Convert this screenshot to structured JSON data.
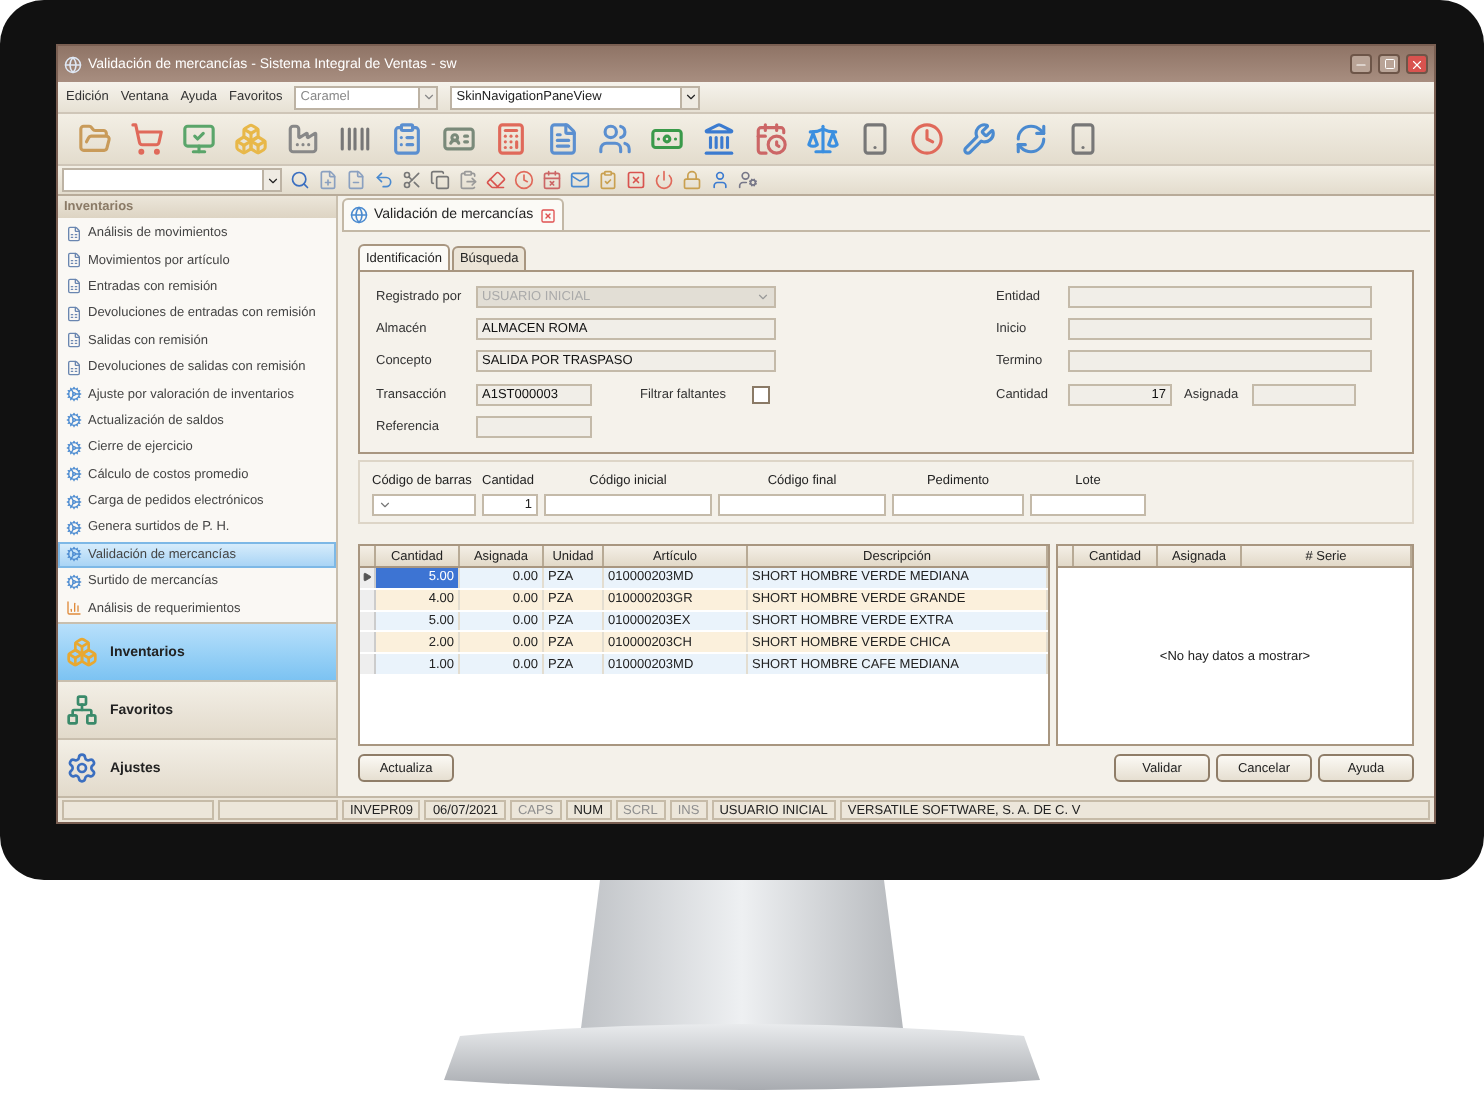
{
  "window": {
    "title": "Validación de mercancías - Sistema Integral de Ventas - sw"
  },
  "menu": [
    "Edición",
    "Ventana",
    "Ayuda",
    "Favoritos"
  ],
  "skin_combo": {
    "value": "Caramel"
  },
  "view_combo": {
    "value": "SkinNavigationPaneView"
  },
  "sidebar": {
    "title": "Inventarios",
    "items": [
      {
        "label": "Análisis de movimientos",
        "kind": "report",
        "selected": false
      },
      {
        "label": "Movimientos por artículo",
        "kind": "report",
        "selected": false
      },
      {
        "label": "Entradas con remisión",
        "kind": "report",
        "selected": false
      },
      {
        "label": "Devoluciones de entradas con remisión",
        "kind": "report",
        "selected": false
      },
      {
        "label": "Salidas con remisión",
        "kind": "report",
        "selected": false
      },
      {
        "label": "Devoluciones de salidas con remisión",
        "kind": "report",
        "selected": false
      },
      {
        "label": "Ajuste por valoración de inventarios",
        "kind": "process",
        "selected": false
      },
      {
        "label": "Actualización de saldos",
        "kind": "process",
        "selected": false
      },
      {
        "label": "Cierre de ejercicio",
        "kind": "process",
        "selected": false
      },
      {
        "label": "Cálculo de costos promedio",
        "kind": "process",
        "selected": false
      },
      {
        "label": "Carga de pedidos electrónicos",
        "kind": "process",
        "selected": false
      },
      {
        "label": "Genera surtidos de P. H.",
        "kind": "process",
        "selected": false
      },
      {
        "label": "Validación de mercancías",
        "kind": "process",
        "selected": true
      },
      {
        "label": "Surtido de mercancías",
        "kind": "process",
        "selected": false
      },
      {
        "label": "Análisis de requerimientos",
        "kind": "chart",
        "selected": false
      }
    ],
    "groups": [
      {
        "label": "Inventarios",
        "kind": "boxes",
        "selected": true
      },
      {
        "label": "Favoritos",
        "kind": "network",
        "selected": false
      },
      {
        "label": "Ajustes",
        "kind": "settings",
        "selected": false
      }
    ]
  },
  "document_tab": {
    "label": "Validación de mercancías"
  },
  "tabs": [
    {
      "label": "Identificación",
      "selected": true
    },
    {
      "label": "Búsqueda",
      "selected": false
    }
  ],
  "form": {
    "left": [
      {
        "label": "Registrado por",
        "value": "USUARIO INICIAL",
        "kind": "combo",
        "disabled": true
      },
      {
        "label": "Almacén",
        "value": "ALMACEN ROMA",
        "kind": "wide",
        "disabled": false
      },
      {
        "label": "Concepto",
        "value": "SALIDA POR TRASPASO",
        "kind": "wide",
        "disabled": false
      },
      {
        "label": "Transacción",
        "value": "A1ST000003",
        "kind": "short",
        "disabled": false
      },
      {
        "label": "Referencia",
        "kind": "short",
        "disabled": false
      }
    ],
    "filter": {
      "label": "Filtrar faltantes",
      "checked": false
    },
    "right": [
      {
        "label": "Entidad"
      },
      {
        "label": "Inicio"
      },
      {
        "label": "Termino"
      }
    ],
    "quantity": {
      "label": "Cantidad",
      "value": "17"
    },
    "assigned": {
      "label": "Asignada"
    }
  },
  "filters": [
    {
      "label": "Código de barras",
      "kind": "combo"
    },
    {
      "label": "Cantidad",
      "value": "1",
      "kind": "number"
    },
    {
      "label": "Código inicial",
      "kind": "text"
    },
    {
      "label": "Código final",
      "kind": "text"
    },
    {
      "label": "Pedimento",
      "kind": "text"
    },
    {
      "label": "Lote",
      "kind": "text"
    }
  ],
  "grid": {
    "columns": [
      "Cantidad",
      "Asignada",
      "Unidad",
      "Artículo",
      "Descripción"
    ],
    "rows": [
      {
        "cells": [
          "5.00",
          "0.00",
          "PZA",
          "010000203MD",
          "SHORT HOMBRE VERDE MEDIANA"
        ],
        "selected": true
      },
      {
        "cells": [
          "4.00",
          "0.00",
          "PZA",
          "010000203GR",
          "SHORT HOMBRE VERDE GRANDE"
        ],
        "selected": false
      },
      {
        "cells": [
          "5.00",
          "0.00",
          "PZA",
          "010000203EX",
          "SHORT HOMBRE VERDE EXTRA"
        ],
        "selected": false
      },
      {
        "cells": [
          "2.00",
          "0.00",
          "PZA",
          "010000203CH",
          "SHORT HOMBRE VERDE CHICA"
        ],
        "selected": false
      },
      {
        "cells": [
          "1.00",
          "0.00",
          "PZA",
          "010000203MD",
          "SHORT HOMBRE CAFE MEDIANA"
        ],
        "selected": false
      }
    ]
  },
  "serial_grid": {
    "columns": [
      "Cantidad",
      "Asignada",
      "# Serie"
    ],
    "empty_text": "<No hay datos a mostrar>"
  },
  "buttons": {
    "left": [
      "Actualiza"
    ],
    "right": [
      "Validar",
      "Cancelar",
      "Ayuda"
    ]
  },
  "status_bar": [
    {
      "text": "INVEPR09",
      "disabled": false
    },
    {
      "text": "06/07/2021",
      "disabled": false
    },
    {
      "text": "CAPS",
      "disabled": true
    },
    {
      "text": "NUM",
      "disabled": false
    },
    {
      "text": "SCRL",
      "disabled": true
    },
    {
      "text": "INS",
      "disabled": true
    },
    {
      "text": "USUARIO INICIAL",
      "disabled": false
    },
    {
      "text": "VERSATILE SOFTWARE, S. A. DE C. V",
      "disabled": false
    }
  ]
}
